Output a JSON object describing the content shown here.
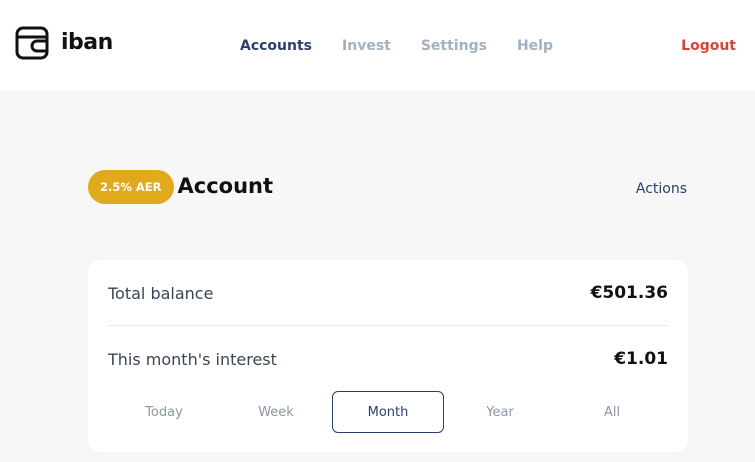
{
  "brand": {
    "name": "iban",
    "logo_icon": "wallet-icon"
  },
  "nav": {
    "items": [
      {
        "label": "Accounts",
        "active": true
      },
      {
        "label": "Invest",
        "active": false
      },
      {
        "label": "Settings",
        "active": false
      },
      {
        "label": "Help",
        "active": false
      }
    ],
    "logout_label": "Logout"
  },
  "account": {
    "badge": "2.5% AER",
    "title": "Account",
    "actions_label": "Actions"
  },
  "summary": {
    "total_balance_label": "Total balance",
    "total_balance_value": "€501.36",
    "interest_label": "This month's interest",
    "interest_value": "€1.01"
  },
  "periods": {
    "options": [
      "Today",
      "Week",
      "Month",
      "Year",
      "All"
    ],
    "selected": "Month"
  },
  "colors": {
    "accent_navy": "#2b3f6c",
    "nav_inactive": "#a1b1c2",
    "logout_red": "#d9443a",
    "badge_gold": "#e1a91c",
    "background": "#f7f7f7"
  }
}
